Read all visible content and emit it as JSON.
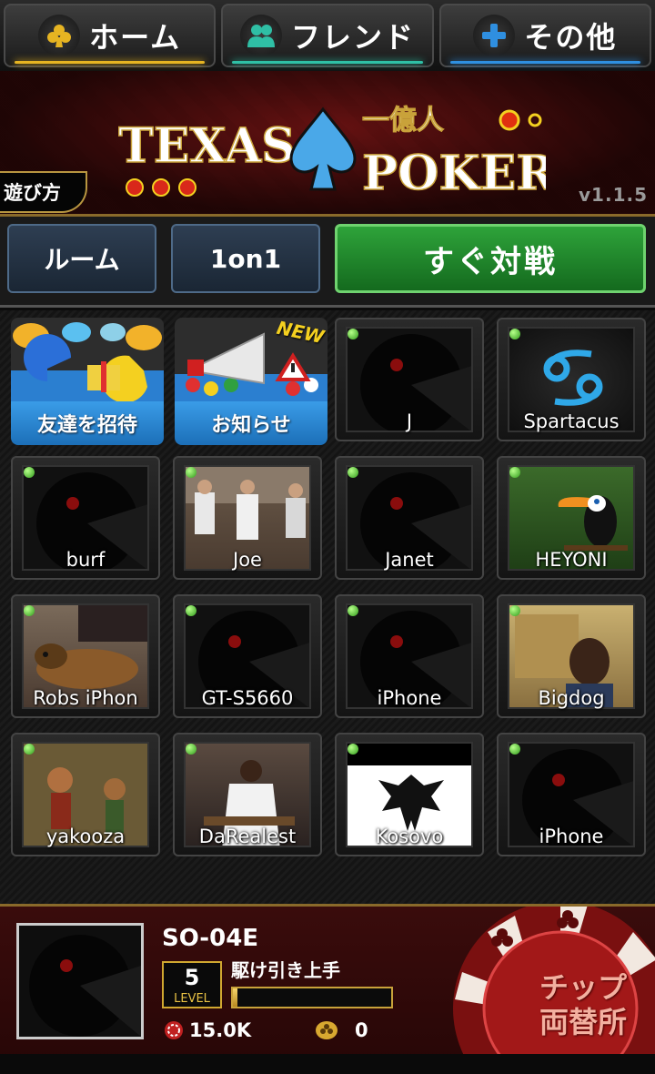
{
  "nav": {
    "tabs": [
      {
        "label": "ホーム",
        "icon": "club-icon",
        "accent": "#e6b422"
      },
      {
        "label": "フレンド",
        "icon": "friends-icon",
        "accent": "#2fbfa5"
      },
      {
        "label": "その他",
        "icon": "plus-icon",
        "accent": "#2f8fe0"
      }
    ]
  },
  "banner": {
    "logo_left": "TEXAS",
    "logo_right": "POKER",
    "logo_top": "一億人",
    "howto_label": "遊び方",
    "version": "v1.1.5"
  },
  "modes": {
    "room_label": "ルーム",
    "oneonone_label": "1on1",
    "quick_label": "すぐ対戦"
  },
  "grid": {
    "invite_label": "友達を招待",
    "news_label": "お知らせ",
    "news_badge": "NEW",
    "friends": [
      {
        "name": "J",
        "avatar": "default"
      },
      {
        "name": "Spartacus",
        "avatar": "cancer-sign"
      },
      {
        "name": "burf",
        "avatar": "default"
      },
      {
        "name": "Joe",
        "avatar": "photo"
      },
      {
        "name": "Janet",
        "avatar": "default"
      },
      {
        "name": "HEYONI",
        "avatar": "toucan"
      },
      {
        "name": "Robs iPhon",
        "avatar": "dog"
      },
      {
        "name": "GT-S5660",
        "avatar": "default"
      },
      {
        "name": "iPhone",
        "avatar": "default"
      },
      {
        "name": "Bigdog",
        "avatar": "photo"
      },
      {
        "name": "yakooza",
        "avatar": "painting"
      },
      {
        "name": "DaRealest",
        "avatar": "photo"
      },
      {
        "name": "Kosovo",
        "avatar": "albania-flag"
      },
      {
        "name": "iPhone",
        "avatar": "default"
      }
    ]
  },
  "player": {
    "name": "SO-04E",
    "level": "5",
    "level_word": "LEVEL",
    "title": "駆け引き上手",
    "exp_progress": 0.03,
    "chips": "15.0K",
    "gold": "0",
    "exchange_label_1": "チップ",
    "exchange_label_2": "両替所"
  }
}
